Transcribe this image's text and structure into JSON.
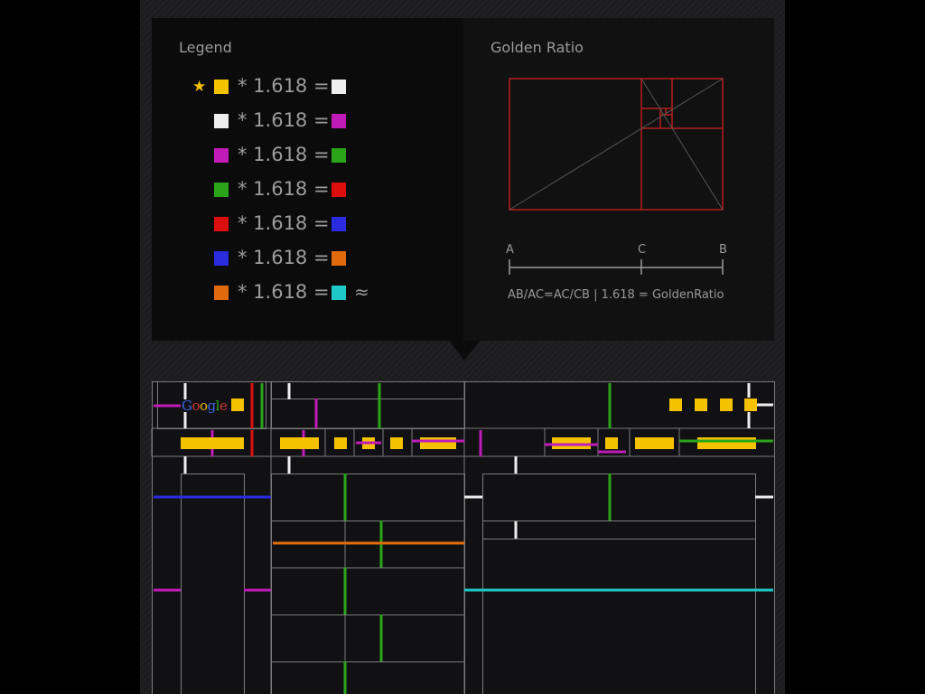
{
  "legend": {
    "title": "Legend",
    "op_text": "* 1.618 =",
    "approx": "≈",
    "rows": [
      {
        "from": "#f5c200",
        "to": "#eeeeee",
        "star": true
      },
      {
        "from": "#eeeeee",
        "to": "#c01bb8"
      },
      {
        "from": "#c01bb8",
        "to": "#2aa51a"
      },
      {
        "from": "#2aa51a",
        "to": "#dd0e0e"
      },
      {
        "from": "#dd0e0e",
        "to": "#2b2be0"
      },
      {
        "from": "#2b2be0",
        "to": "#e06a0c"
      },
      {
        "from": "#e06a0c",
        "to": "#1fc8c8",
        "approx": true
      }
    ]
  },
  "golden": {
    "title": "Golden Ratio",
    "point_a": "A",
    "point_c": "C",
    "point_b": "B",
    "formula": "AB/AC=AC/CB  |  1.618 = GoldenRatio"
  },
  "wireframe": {
    "logo_text": "Google",
    "logo_colors": [
      "#3b66e0",
      "#d43a2a",
      "#e6b400",
      "#3b66e0",
      "#2aa51a",
      "#d43a2a"
    ]
  },
  "colors": {
    "yellow": "#f5c200",
    "white": "#eeeeee",
    "magenta": "#c01bb8",
    "green": "#2aa51a",
    "red": "#dd0e0e",
    "blue": "#2b2be0",
    "orange": "#e06a0c",
    "cyan": "#1fc8c8",
    "grid_line": "#7c7c7c",
    "golden_line": "#b3201a"
  }
}
